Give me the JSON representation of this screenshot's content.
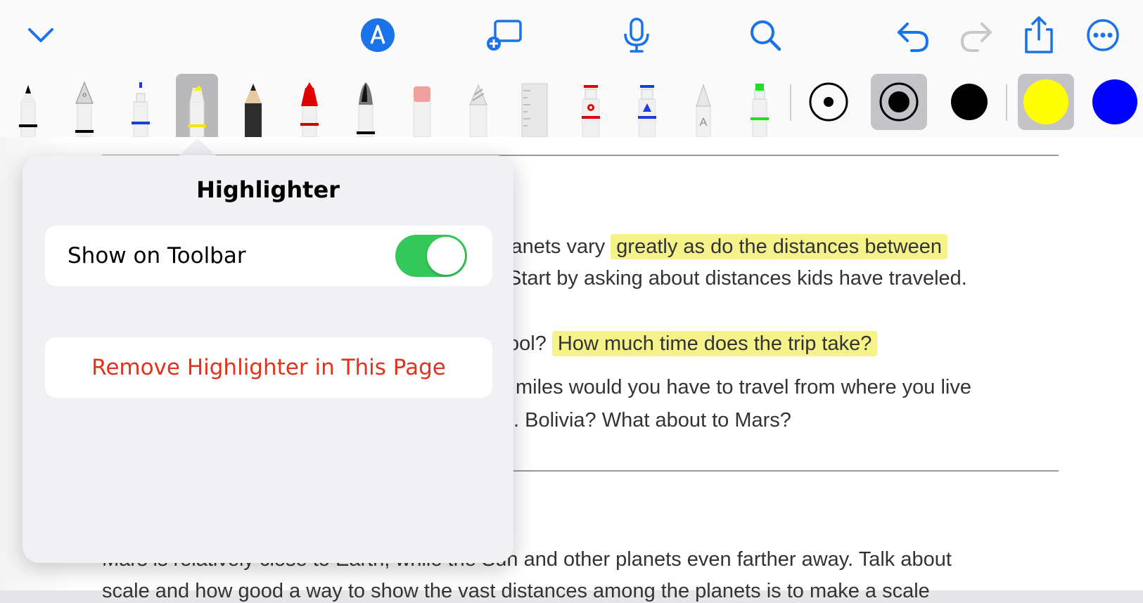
{
  "toolbar": {
    "collapse_icon": "chevron-down-icon",
    "markup_icon": "pencil-tip-circle-icon",
    "add_page_icon": "add-rectangle-icon",
    "dictation_icon": "microphone-icon",
    "search_icon": "magnifying-glass-icon",
    "undo_icon": "undo-arrow-icon",
    "redo_icon": "redo-arrow-icon",
    "share_icon": "share-icon",
    "more_icon": "ellipsis-circle-icon",
    "accent_color": "#1a73e8"
  },
  "tools": [
    {
      "name": "pen",
      "color": "#000000"
    },
    {
      "name": "fountain-pen",
      "color": "#000000"
    },
    {
      "name": "fine-liner",
      "color": "#0000ff"
    },
    {
      "name": "highlighter",
      "color": "#ffff00",
      "selected": true
    },
    {
      "name": "pencil",
      "color": "#333333"
    },
    {
      "name": "crayon",
      "color": "#ff0000"
    },
    {
      "name": "watercolor-brush",
      "color": "#000000"
    },
    {
      "name": "eraser",
      "color": "#f2a0a0"
    },
    {
      "name": "lasso",
      "color": "#bbbbbb"
    },
    {
      "name": "ruler",
      "color": "#cccccc"
    },
    {
      "name": "shape-tool",
      "color": "#ff0000"
    },
    {
      "name": "fill-tool",
      "color": "#0000ff"
    },
    {
      "name": "text-tool",
      "label": "A",
      "color": "#999999"
    },
    {
      "name": "marker",
      "color": "#00e000"
    }
  ],
  "stroke_sizes": [
    "small",
    "medium",
    "large"
  ],
  "selected_stroke": "medium",
  "colors": [
    "#ffff00",
    "#0000ff"
  ],
  "selected_color": "#ffff00",
  "popover": {
    "title": "Highlighter",
    "toggle_label": "Show on Toolbar",
    "toggle_on": true,
    "remove_label": "Remove Highlighter in This Page"
  },
  "document": {
    "line1_plain": "lanets vary",
    "line1_highlight": "greatly as do the distances between",
    "line2": "Start by asking about distances kids have traveled.",
    "line3_plain": "ool?",
    "line3_highlight": "How much time does the trip take?",
    "line4": "miles would you have to travel from where you live",
    "line5": ". Bolivia? What about to Mars?",
    "line6": "Mars is relatively close to Earth, while the Sun and other planets even farther away. Talk about",
    "line7": "scale and how good a way to show the vast distances among the planets is to make a scale"
  }
}
